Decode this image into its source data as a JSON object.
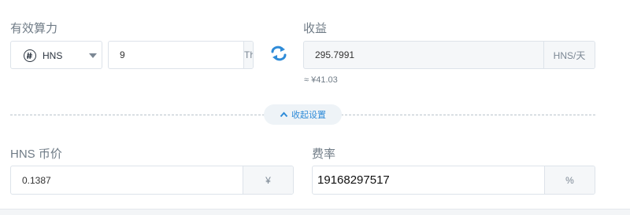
{
  "hashrate": {
    "label": "有效算力",
    "coin": "HNS",
    "value": "9",
    "unit": "Thash/s"
  },
  "revenue": {
    "label": "收益",
    "value": "295.7991",
    "unit": "HNS/天",
    "approx": "≈ ¥41.03"
  },
  "collapse": {
    "label": "收起设置"
  },
  "price": {
    "label": "HNS 币价",
    "value": "0.1387",
    "unit": "¥"
  },
  "fee": {
    "label": "费率",
    "value": "19168297517",
    "unit": "%"
  },
  "icons": {
    "coin": "handshake-coin-icon",
    "select_caret": "caret-down-icon",
    "swap": "swap-icon",
    "collapse": "chevron-up-icon"
  },
  "colors": {
    "accent": "#2e8bd8",
    "label": "#6f7b86",
    "border": "#dde3ea",
    "readonly_bg": "#f5f7f9"
  }
}
